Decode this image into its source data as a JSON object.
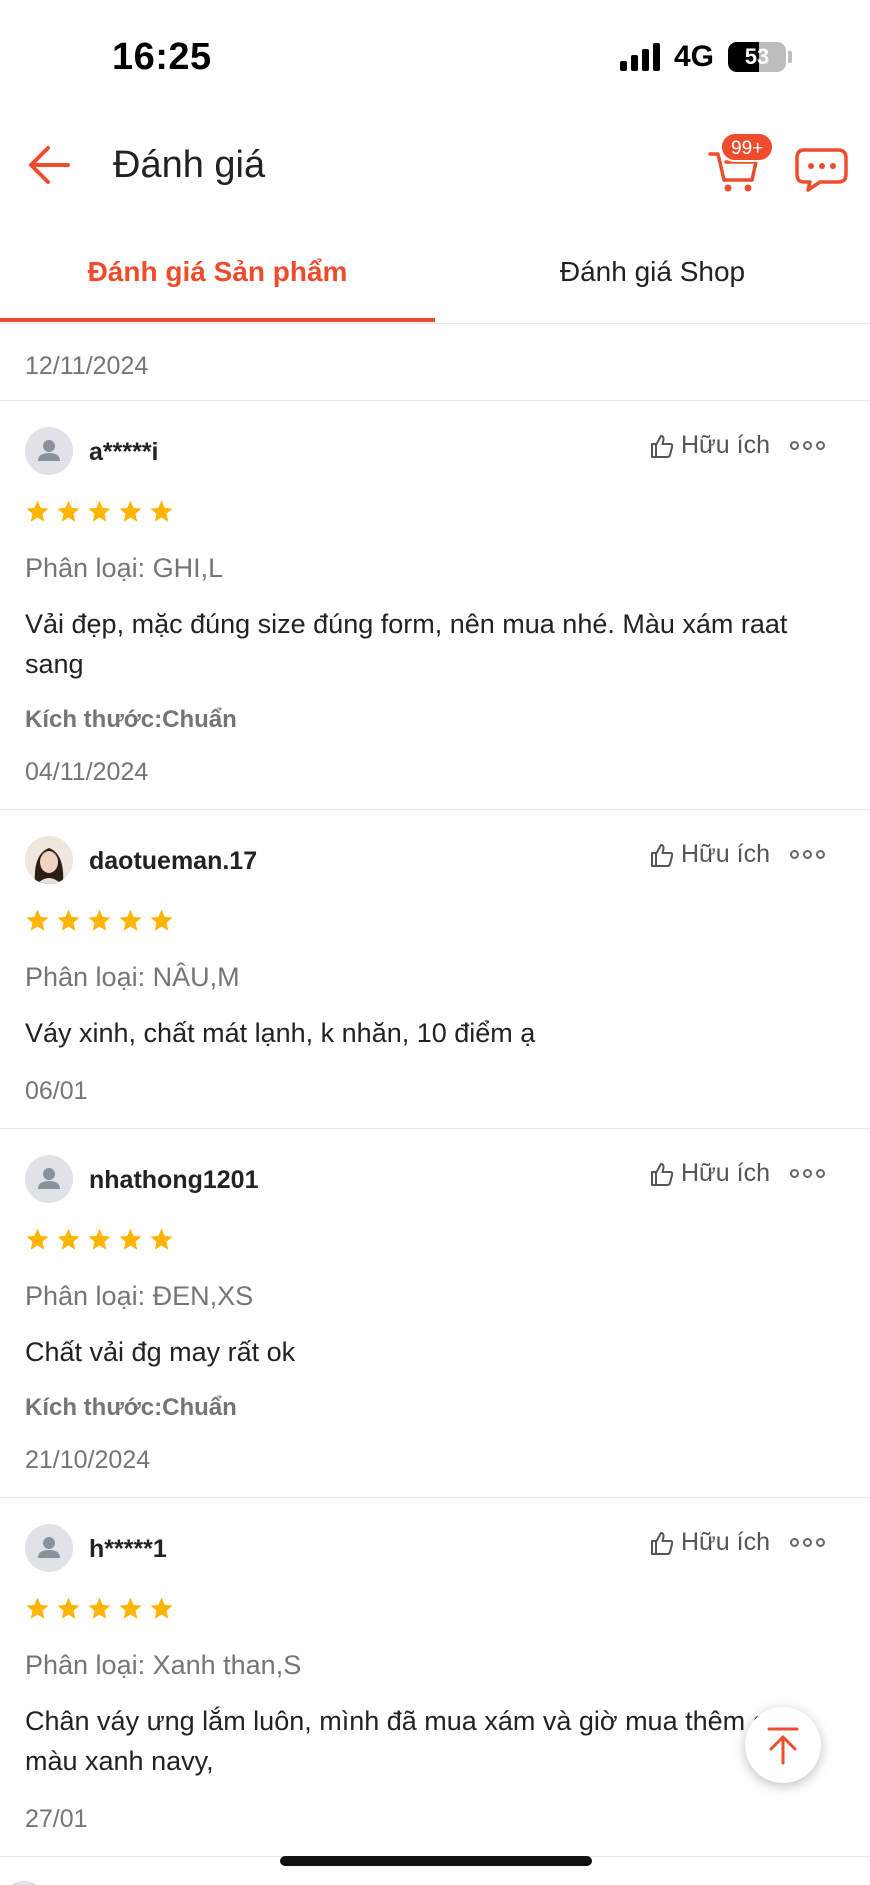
{
  "status_bar": {
    "time": "16:25",
    "network": "4G",
    "battery": "53"
  },
  "header": {
    "title": "Đánh giá",
    "cart_badge": "99+",
    "accent_color": "#ee4d2d"
  },
  "tabs": [
    {
      "label": "Đánh giá Sản phẩm",
      "active": true
    },
    {
      "label": "Đánh giá Shop",
      "active": false
    }
  ],
  "partial_prev_date": "12/11/2024",
  "helpful_label": "Hữu ích",
  "reviews": [
    {
      "username": "a*****i",
      "avatar": "default-avatar",
      "rating": 5,
      "variant": "Phân loại: GHI,L",
      "content": "Vải đẹp, mặc đúng size đúng form, nên mua nhé. Màu xám raat sang",
      "size_fit": "Kích thước:Chuẩn",
      "date": "04/11/2024"
    },
    {
      "username": "daotueman.17",
      "avatar": "photo-avatar",
      "rating": 5,
      "variant": "Phân loại: NÂU,M",
      "content": "Váy xinh, chất mát lạnh, k nhăn, 10 điểm ạ",
      "size_fit": "",
      "date": "06/01"
    },
    {
      "username": "nhathong1201",
      "avatar": "default-avatar",
      "rating": 5,
      "variant": "Phân loại: ĐEN,XS",
      "content": "Chất vải đg may rất ok",
      "size_fit": "Kích thước:Chuẩn",
      "date": "21/10/2024"
    },
    {
      "username": "h*****1",
      "avatar": "default-avatar",
      "rating": 5,
      "variant": "Phân loại: Xanh than,S",
      "content": "Chân váy ưng lắm luôn, mình đã mua xám và giờ mua thêm cả màu xanh navy,",
      "size_fit": "",
      "date": "27/01"
    }
  ],
  "icons": {
    "back": "arrow-left-icon",
    "cart": "cart-icon",
    "chat": "chat-icon",
    "helpful": "thumbs-up-icon",
    "more": "more-dots-icon",
    "star": "star-icon",
    "scroll_top": "arrow-up-icon"
  },
  "colors": {
    "star": "#ffb400",
    "text_secondary": "#757575"
  }
}
